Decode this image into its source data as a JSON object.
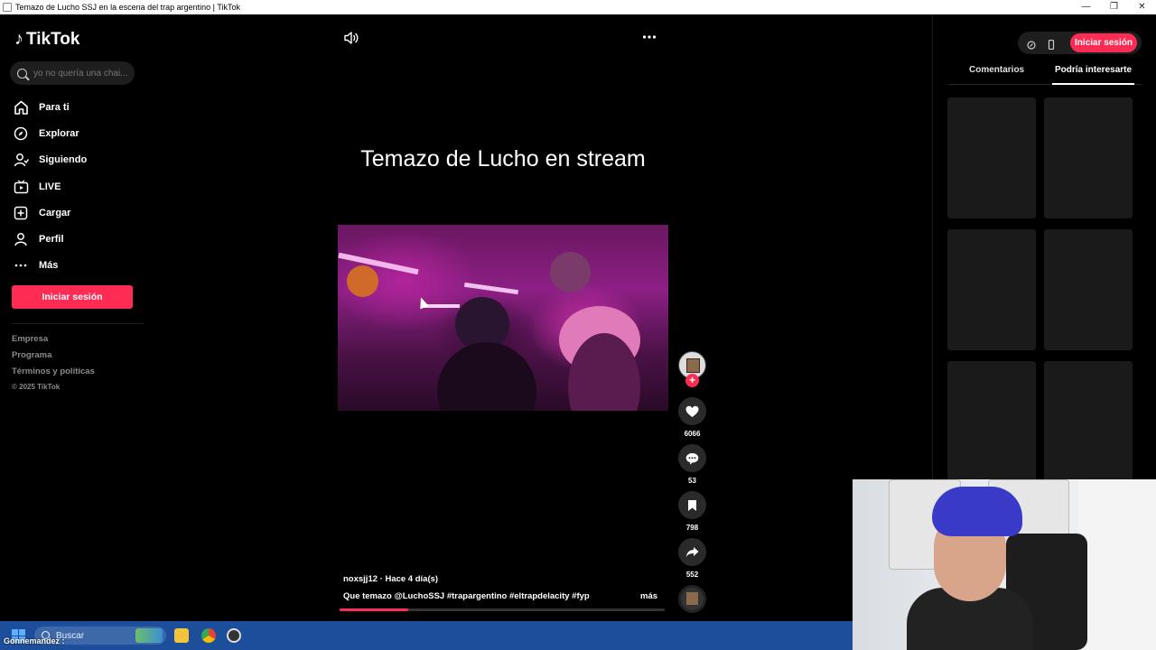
{
  "window": {
    "title": "Temazo de Lucho SSJ en la escena del trap argentino | TikTok",
    "controls": [
      "—",
      "❐",
      "✕"
    ]
  },
  "sidebar": {
    "logo_text": "TikTok",
    "search_placeholder": "yo no quería una chai...",
    "nav": [
      {
        "label": "Para ti",
        "icon": "home-icon"
      },
      {
        "label": "Explorar",
        "icon": "compass-icon"
      },
      {
        "label": "Siguiendo",
        "icon": "following-icon"
      },
      {
        "label": "LIVE",
        "icon": "live-icon"
      },
      {
        "label": "Cargar",
        "icon": "upload-icon"
      },
      {
        "label": "Perfil",
        "icon": "profile-icon"
      },
      {
        "label": "Más",
        "icon": "more-icon"
      }
    ],
    "login_label": "Iniciar sesión",
    "footer": {
      "company": "Empresa",
      "program": "Programa",
      "terms": "Términos y políticas",
      "copyright": "© 2025 TikTok"
    }
  },
  "video": {
    "title_text": "Temazo de Lucho en stream",
    "author": "noxsjj12 · Hace 4 día(s)",
    "caption": "Que temazo @LuchoSSJ  #trapargentino  #eltrapdelacity  #fyp",
    "more_label": "más",
    "progress": 0.21
  },
  "actions": {
    "likes": "6066",
    "comments": "53",
    "saves": "798",
    "shares": "552",
    "follow_symbol": "+"
  },
  "right_panel": {
    "login_label": "Iniciar sesión",
    "tabs": [
      {
        "label": "Comentarios",
        "active": false
      },
      {
        "label": "Podría interesarte",
        "active": true
      }
    ]
  },
  "taskbar": {
    "search_label": "Buscar",
    "overlay_name": "Gonnemandez :"
  },
  "colors": {
    "accent": "#fe2c55",
    "background": "#000000",
    "taskbar": "#1c4e9c"
  }
}
